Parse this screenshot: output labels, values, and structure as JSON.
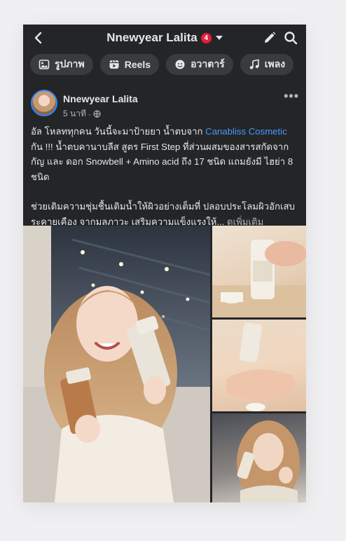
{
  "header": {
    "title": "Nnewyear Lalita",
    "badge_count": "4",
    "icons": [
      "back-arrow-icon",
      "caret-down-icon",
      "pencil-icon",
      "search-icon"
    ]
  },
  "chips": [
    {
      "label": "รูปภาพ",
      "icon": "photos-icon"
    },
    {
      "label": "Reels",
      "icon": "reels-icon"
    },
    {
      "label": "อวาตาร์",
      "icon": "avatar-icon"
    },
    {
      "label": "เพลง",
      "icon": "music-icon"
    }
  ],
  "post": {
    "author": "Nnewyear Lalita",
    "time": "5 นาที",
    "time_separator": "·",
    "privacy_icon": "globe-icon",
    "text_line1_a": "อัล โหลททุกคน วันนี้จะมาป้ายยา น้ำตบจาก ",
    "brand_link": "Canabliss Cosmetic",
    "text_line1_b": " กัน !!! น้ำตบคานาบลีส สูตร First Step ที่ส่วนผสมของสารสกัดจากกัญ และ ดอก Snowbell + Amino acid ถึง 17 ชนิด แถมยังมี ไฮย่า 8 ชนิด",
    "text_para2": "ช่วยเติมความชุ่มชื้นเติมน้ำให้ผิวอย่างเต็มที่ ปลอบประโลมผิวอักเสบ ระคายเคือง จากมลภาวะ เสริมความแข็งแรงให้... ",
    "see_more": "ดูเพิ่มเติม"
  },
  "colors": {
    "background": "#242526",
    "text": "#e4e6eb",
    "secondary_text": "#b0b3b8",
    "link": "#4599ff",
    "badge": "#e41e3f",
    "chip": "#3a3b3c"
  }
}
